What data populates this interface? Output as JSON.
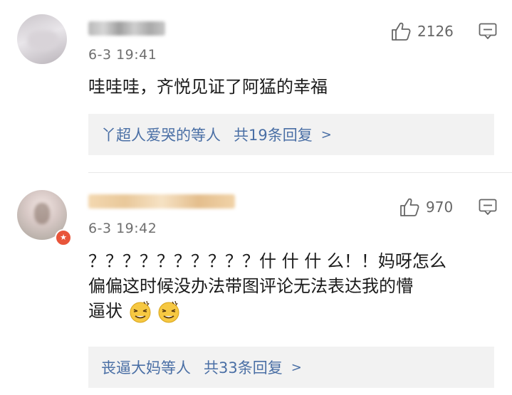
{
  "comments": [
    {
      "time": "6-3 19:41",
      "likes": "2126",
      "text": "哇哇哇，齐悦见证了阿猛的幸福",
      "reply_names": "丫超人爱哭的等人",
      "reply_count": "共19条回复",
      "reply_chevron": ">"
    },
    {
      "time": "6-3 19:42",
      "likes": "970",
      "text_line1": "？？？？？？？？？？什 什 什 么！！妈呀怎么",
      "text_line2": "偏偏这时候没办法带图评论无法表达我的懵",
      "text_line3": "逼状",
      "reply_names": "丧逼大妈等人",
      "reply_count": "共33条回复",
      "reply_chevron": ">"
    }
  ],
  "icons": {
    "like": "thumbs-up-icon",
    "reply": "comment-bubble-icon",
    "verified": "verified-badge-icon",
    "emoji": "dizzy-face-emoji"
  },
  "colors": {
    "link": "#4a6fa5",
    "reply_bg": "#f2f2f2",
    "badge": "#e8553a",
    "meta": "#6f6f6f"
  }
}
